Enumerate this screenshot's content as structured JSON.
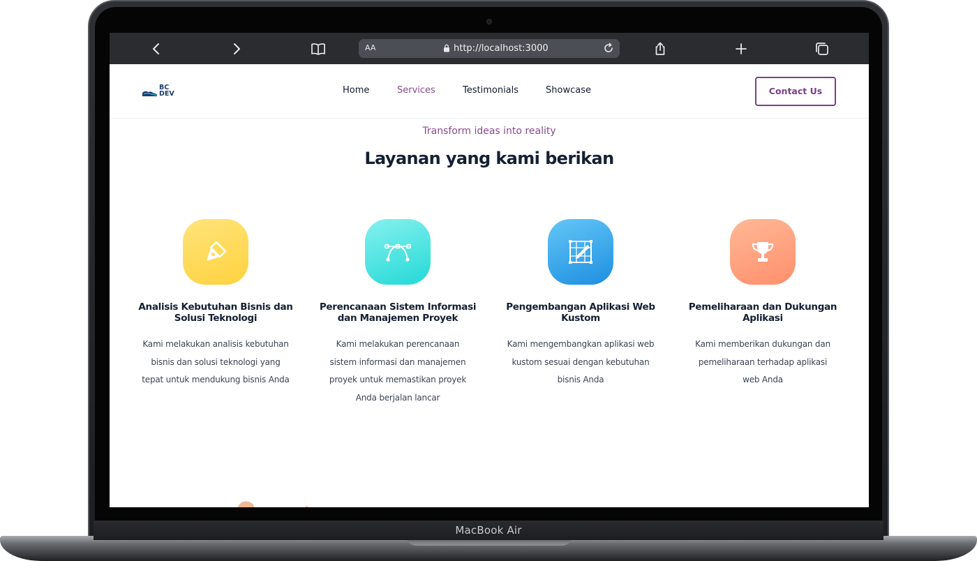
{
  "device": {
    "label": "MacBook Air"
  },
  "browser": {
    "url_text_size": "AA",
    "url": "http://localhost:3000",
    "icons": [
      "back-icon",
      "forward-icon",
      "bookmarks-icon",
      "lock-icon",
      "reload-icon",
      "share-icon",
      "new-tab-icon",
      "tabs-icon"
    ]
  },
  "header": {
    "logo_text": "BC DEV",
    "nav": [
      {
        "label": "Home",
        "active": false
      },
      {
        "label": "Services",
        "active": true
      },
      {
        "label": "Testimonials",
        "active": false
      },
      {
        "label": "Showcase",
        "active": false
      }
    ],
    "contact_label": "Contact Us"
  },
  "services": {
    "tagline": "Transform ideas into reality",
    "title": "Layanan yang kami berikan",
    "cards": [
      {
        "icon": "pen-nib-icon",
        "color": "#ffd84f",
        "title": "Analisis Kebutuhan Bisnis dan Solusi Teknologi",
        "description": "Kami melakukan analisis kebutuhan bisnis dan solusi teknologi yang tepat untuk mendukung bisnis Anda"
      },
      {
        "icon": "bezier-curve-icon",
        "color": "#3fe0dd",
        "title": "Perencanaan Sistem Informasi dan Manajemen Proyek",
        "description": "Kami melakukan perencanaan sistem informasi dan manajemen proyek untuk memastikan proyek Anda berjalan lancar"
      },
      {
        "icon": "design-edit-icon",
        "color": "#34a8ec",
        "title": "Pengembangan Aplikasi Web Kustom",
        "description": "Kami mengembangkan aplikasi web kustom sesuai dengan kebutuhan bisnis Anda"
      },
      {
        "icon": "trophy-icon",
        "color": "#ffa07c",
        "title": "Pemeliharaan dan Dukungan Aplikasi",
        "description": "Kami memberikan dukungan dan pemeliharaan terhadap aplikasi web Anda"
      }
    ]
  }
}
